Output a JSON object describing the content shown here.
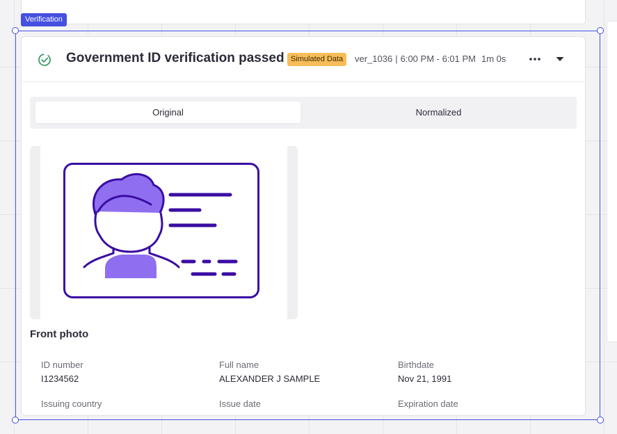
{
  "selection": {
    "tag": "Verification"
  },
  "header": {
    "title": "Government ID verification passed",
    "badge": "Simulated Data",
    "verification_id": "ver_1036",
    "separator": "|",
    "time_range": "6:00 PM - 6:01 PM",
    "duration": "1m 0s",
    "status_icon": "check-circle-icon",
    "status_color": "#3a9a68"
  },
  "tabs": [
    {
      "label": "Original",
      "active": true
    },
    {
      "label": "Normalized",
      "active": false
    }
  ],
  "photo": {
    "caption": "Front photo",
    "illustration": "id-card-illustration",
    "outline_color": "#3a0ca3",
    "fill_color": "#8f6ff0"
  },
  "fields": {
    "id_number": {
      "label": "ID number",
      "value": "I1234562"
    },
    "full_name": {
      "label": "Full name",
      "value": "ALEXANDER J SAMPLE"
    },
    "birthdate": {
      "label": "Birthdate",
      "value": "Nov 21, 1991"
    },
    "issuing_country": {
      "label": "Issuing country",
      "value": ""
    },
    "issue_date": {
      "label": "Issue date",
      "value": ""
    },
    "expiration_date": {
      "label": "Expiration date",
      "value": ""
    }
  },
  "colors": {
    "selection": "#4550e0",
    "badge_bg": "#f7bd58"
  }
}
